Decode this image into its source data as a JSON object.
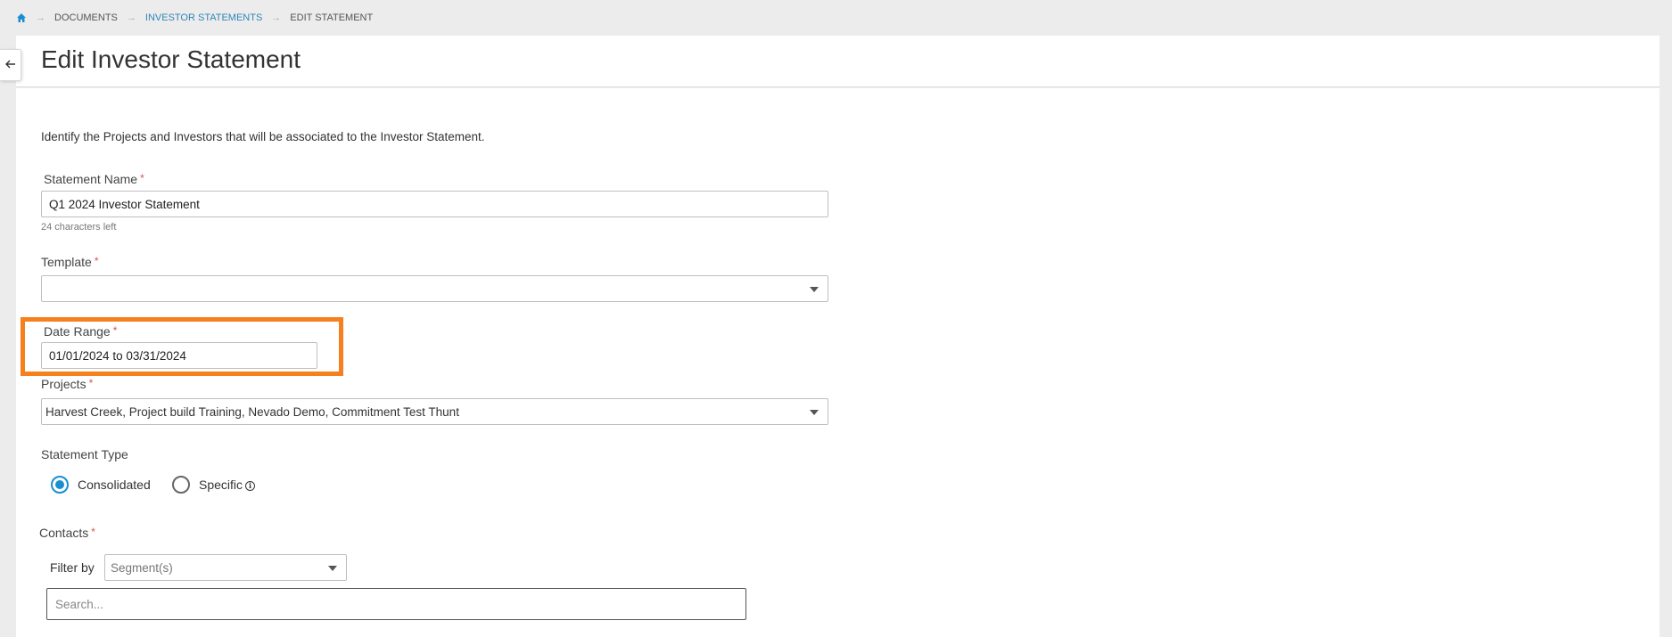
{
  "breadcrumb": {
    "home_icon": "home-icon",
    "items": [
      "DOCUMENTS",
      "INVESTOR STATEMENTS",
      "EDIT STATEMENT"
    ],
    "separator": "→"
  },
  "header": {
    "title": "Edit Investor Statement"
  },
  "form": {
    "intro": "Identify the Projects and Investors that will be associated to the Investor Statement.",
    "required_marker": "*",
    "statement_name": {
      "label": "Statement Name",
      "value": "Q1 2024 Investor Statement",
      "hint": "24 characters left"
    },
    "template": {
      "label": "Template",
      "value": ""
    },
    "date_range": {
      "label": "Date Range",
      "value": "01/01/2024 to 03/31/2024"
    },
    "projects": {
      "label": "Projects",
      "value": "Harvest Creek, Project build Training, Nevado Demo, Commitment Test Thunt"
    },
    "statement_type": {
      "label": "Statement Type",
      "options": [
        {
          "label": "Consolidated",
          "checked": true
        },
        {
          "label": "Specific",
          "checked": false
        }
      ],
      "info_icon": "info-icon"
    },
    "contacts": {
      "label": "Contacts",
      "filter_label": "Filter by",
      "filter_placeholder": "Segment(s)",
      "search_placeholder": "Search..."
    }
  },
  "colors": {
    "accent": "#1a8fd0",
    "link": "#2f86b8",
    "highlight": "#f7801e",
    "required": "#d9534f"
  }
}
